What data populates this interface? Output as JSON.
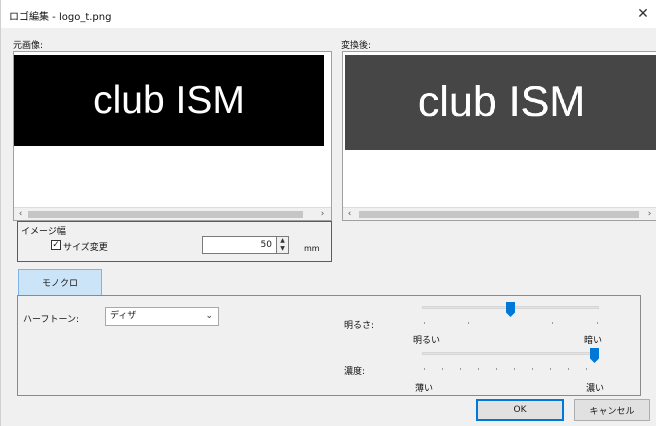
{
  "window": {
    "title": "ロゴ編集 - logo_t.png",
    "close_glyph": "✕"
  },
  "original": {
    "label": "元画像:",
    "image_text": "club ISM"
  },
  "converted": {
    "label": "変換後:",
    "image_text": "club ISM"
  },
  "scroll": {
    "left_glyph": "‹",
    "right_glyph": "›"
  },
  "image_width": {
    "group_label": "イメージ幅",
    "resize_label": "サイズ変更",
    "resize_checked": true,
    "check_glyph": "✓",
    "value": "50",
    "unit": "mm",
    "spin_up_glyph": "▲",
    "spin_down_glyph": "▼"
  },
  "tabs": [
    {
      "label": "モノクロ",
      "active": true
    }
  ],
  "halftone": {
    "label": "ハーフトーン:",
    "selected": "ディザ",
    "chevron": "⌄"
  },
  "brightness": {
    "label": "明るさ:",
    "min_label": "明るい",
    "max_label": "暗い",
    "level": 0.5
  },
  "density": {
    "label": "濃度:",
    "min_label": "薄い",
    "max_label": "濃い",
    "level": 1.0
  },
  "buttons": {
    "ok": "OK",
    "cancel": "キャンセル"
  },
  "colors": {
    "accent": "#0078d7",
    "highlight_border": "#d9262c",
    "tab_bg": "#cce4f7"
  }
}
